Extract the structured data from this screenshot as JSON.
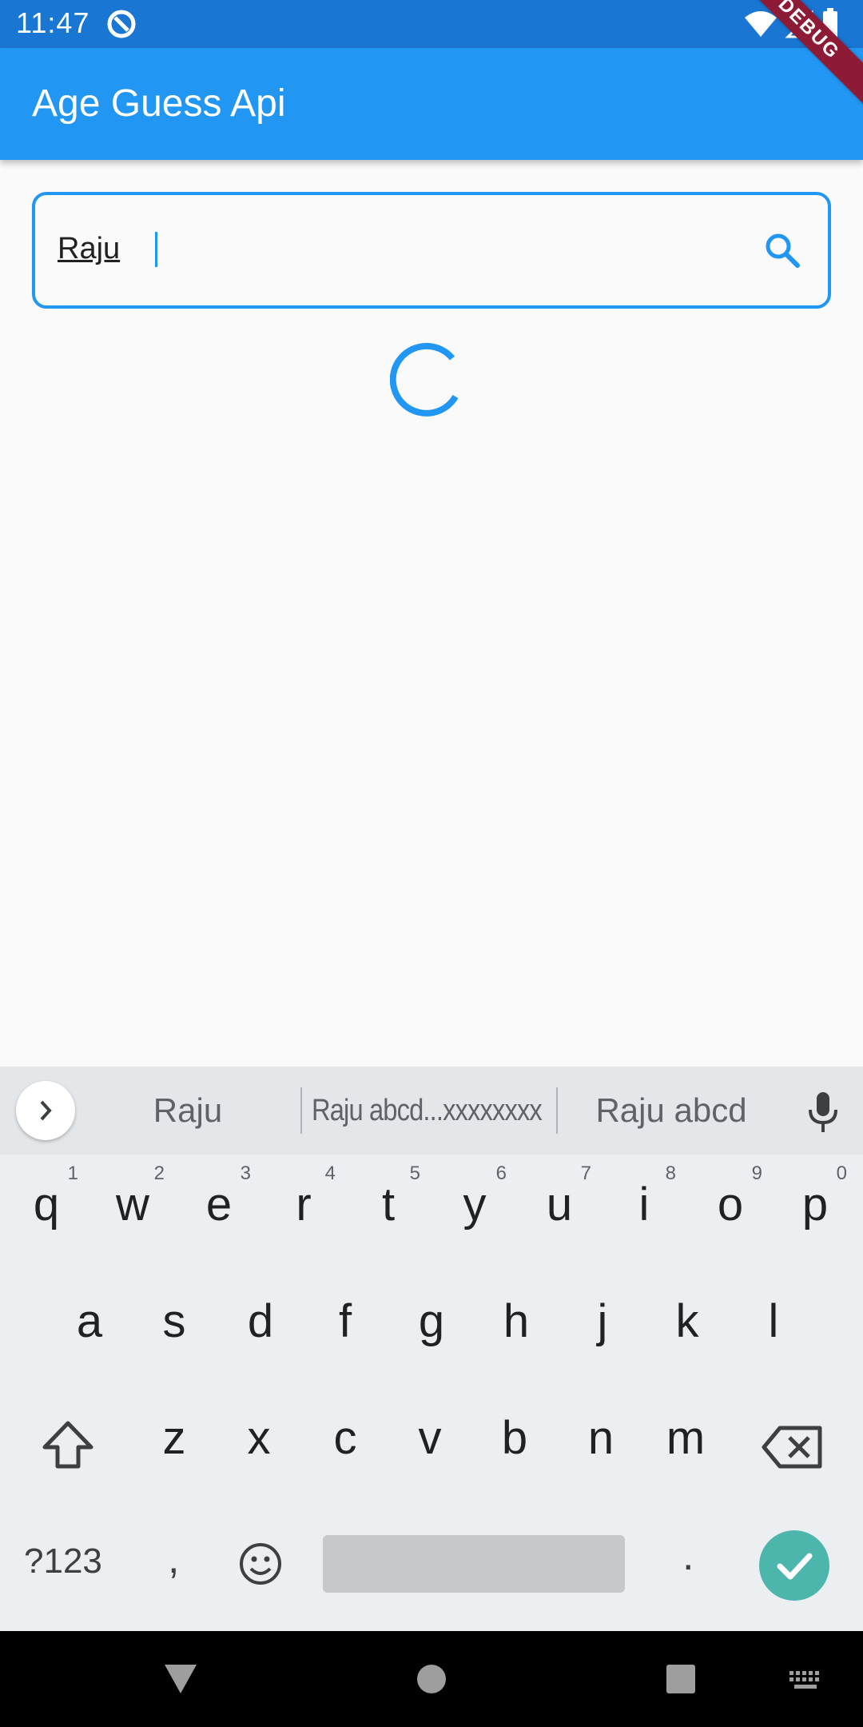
{
  "status_bar": {
    "time": "11:47"
  },
  "debug_banner": "DEBUG",
  "app_bar": {
    "title": "Age Guess Api"
  },
  "search": {
    "value": "Raju"
  },
  "keyboard": {
    "suggestions": [
      "Raju",
      "Raju abcd...xxxxxxxx",
      "Raju abcd"
    ],
    "row1": [
      {
        "char": "q",
        "hint": "1"
      },
      {
        "char": "w",
        "hint": "2"
      },
      {
        "char": "e",
        "hint": "3"
      },
      {
        "char": "r",
        "hint": "4"
      },
      {
        "char": "t",
        "hint": "5"
      },
      {
        "char": "y",
        "hint": "6"
      },
      {
        "char": "u",
        "hint": "7"
      },
      {
        "char": "i",
        "hint": "8"
      },
      {
        "char": "o",
        "hint": "9"
      },
      {
        "char": "p",
        "hint": "0"
      }
    ],
    "row2": [
      "a",
      "s",
      "d",
      "f",
      "g",
      "h",
      "j",
      "k",
      "l"
    ],
    "row3": [
      "z",
      "x",
      "c",
      "v",
      "b",
      "n",
      "m"
    ],
    "symbols_label": "?123",
    "comma": ",",
    "period": "."
  },
  "colors": {
    "primary": "#2196f3",
    "status_bar": "#1976d2",
    "accent_done": "#4db6ac",
    "debug": "#8e1b36"
  }
}
